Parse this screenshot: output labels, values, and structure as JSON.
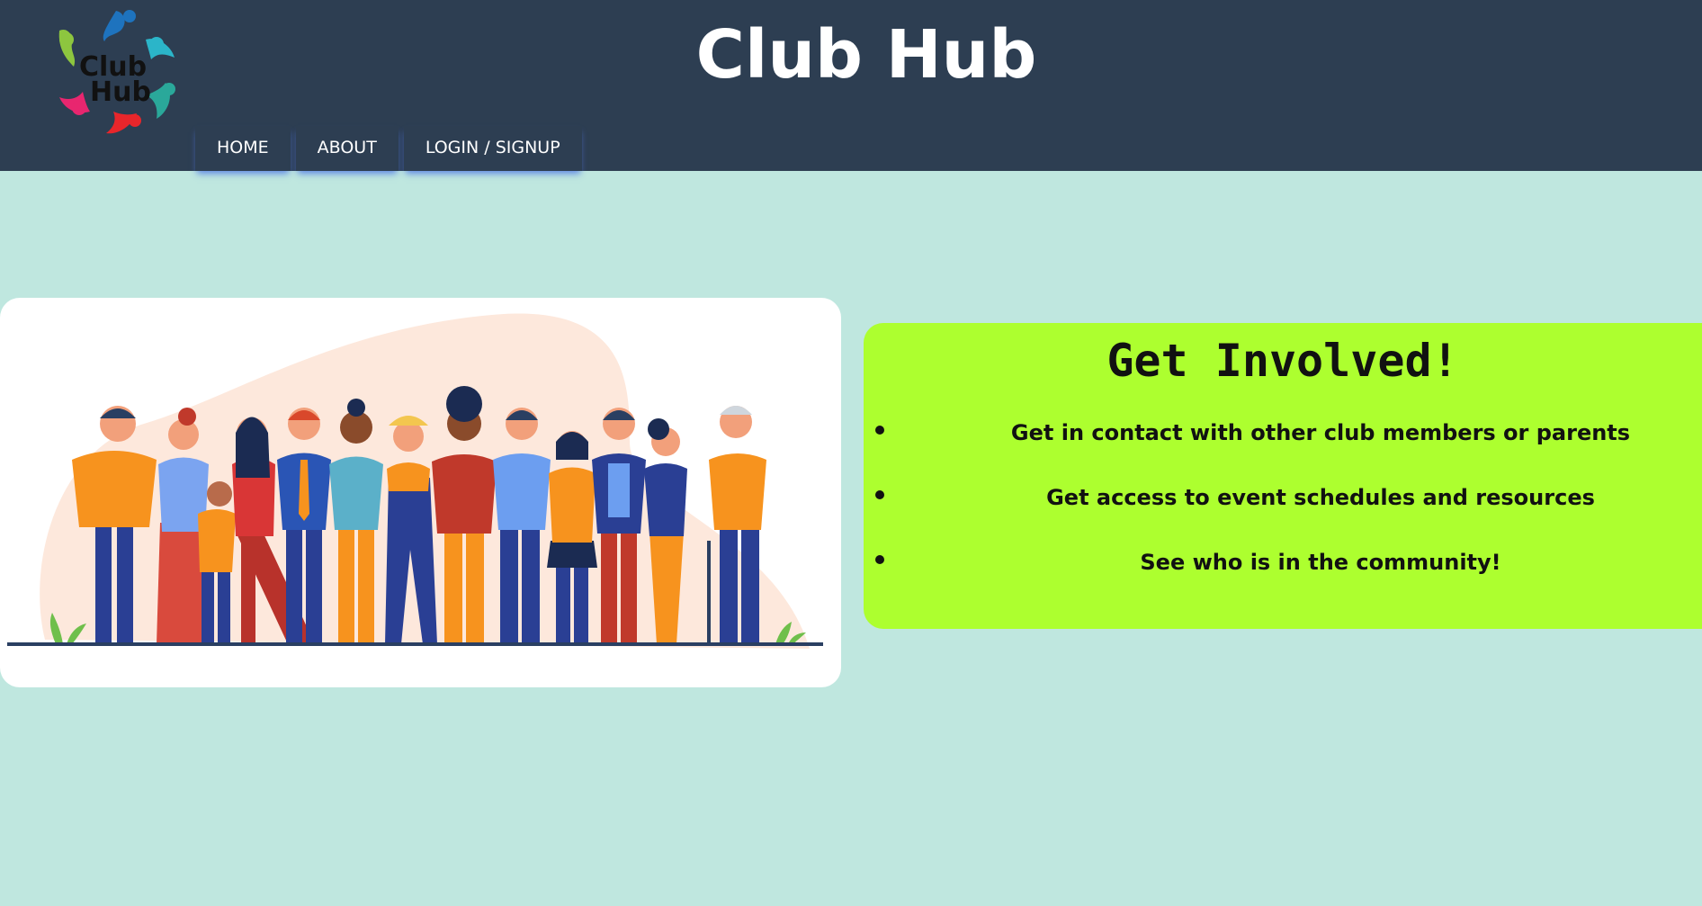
{
  "header": {
    "title": "Club Hub",
    "logo": {
      "line1": "Club",
      "line2": "Hub"
    }
  },
  "nav": {
    "items": [
      {
        "label": "HOME"
      },
      {
        "label": "ABOUT"
      },
      {
        "label": "LOGIN / SIGNUP"
      }
    ]
  },
  "hero": {
    "image_icon": "community-people-illustration"
  },
  "info": {
    "heading": "Get Involved!",
    "items": [
      "Get in contact with other club members or parents",
      "Get access to event schedules and resources",
      "See who is in the community!"
    ]
  },
  "colors": {
    "header_bg": "#2d3e52",
    "page_bg": "#bfe7df",
    "info_bg": "#adff2f",
    "nav_shadow": "#5078e6"
  }
}
